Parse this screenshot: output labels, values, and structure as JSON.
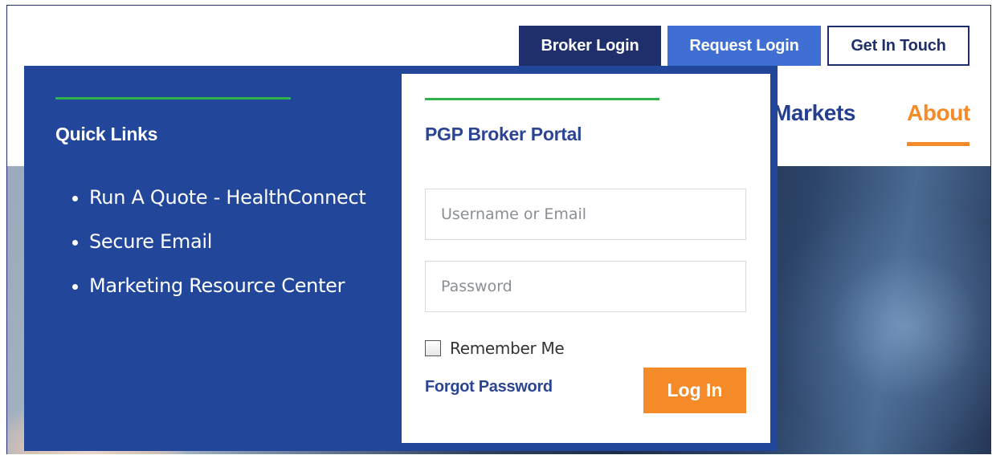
{
  "header": {
    "broker_login": "Broker Login",
    "request_login": "Request Login",
    "get_in_touch": "Get In Touch"
  },
  "nav": {
    "markets": "Markets",
    "about": "About"
  },
  "quick_links": {
    "title": "Quick Links",
    "items": [
      {
        "label": "Run A Quote - HealthConnect"
      },
      {
        "label": "Secure Email"
      },
      {
        "label": "Marketing Resource Center"
      }
    ]
  },
  "login": {
    "title": "PGP Broker Portal",
    "username_placeholder": "Username or Email",
    "password_placeholder": "Password",
    "remember_label": "Remember Me",
    "forgot_label": "Forgot Password",
    "submit_label": "Log In"
  },
  "colors": {
    "panel_blue": "#21469a",
    "navy": "#1e2f6b",
    "button_blue": "#3f6fd2",
    "accent_orange": "#f58b28",
    "accent_green": "#2fb24a"
  }
}
